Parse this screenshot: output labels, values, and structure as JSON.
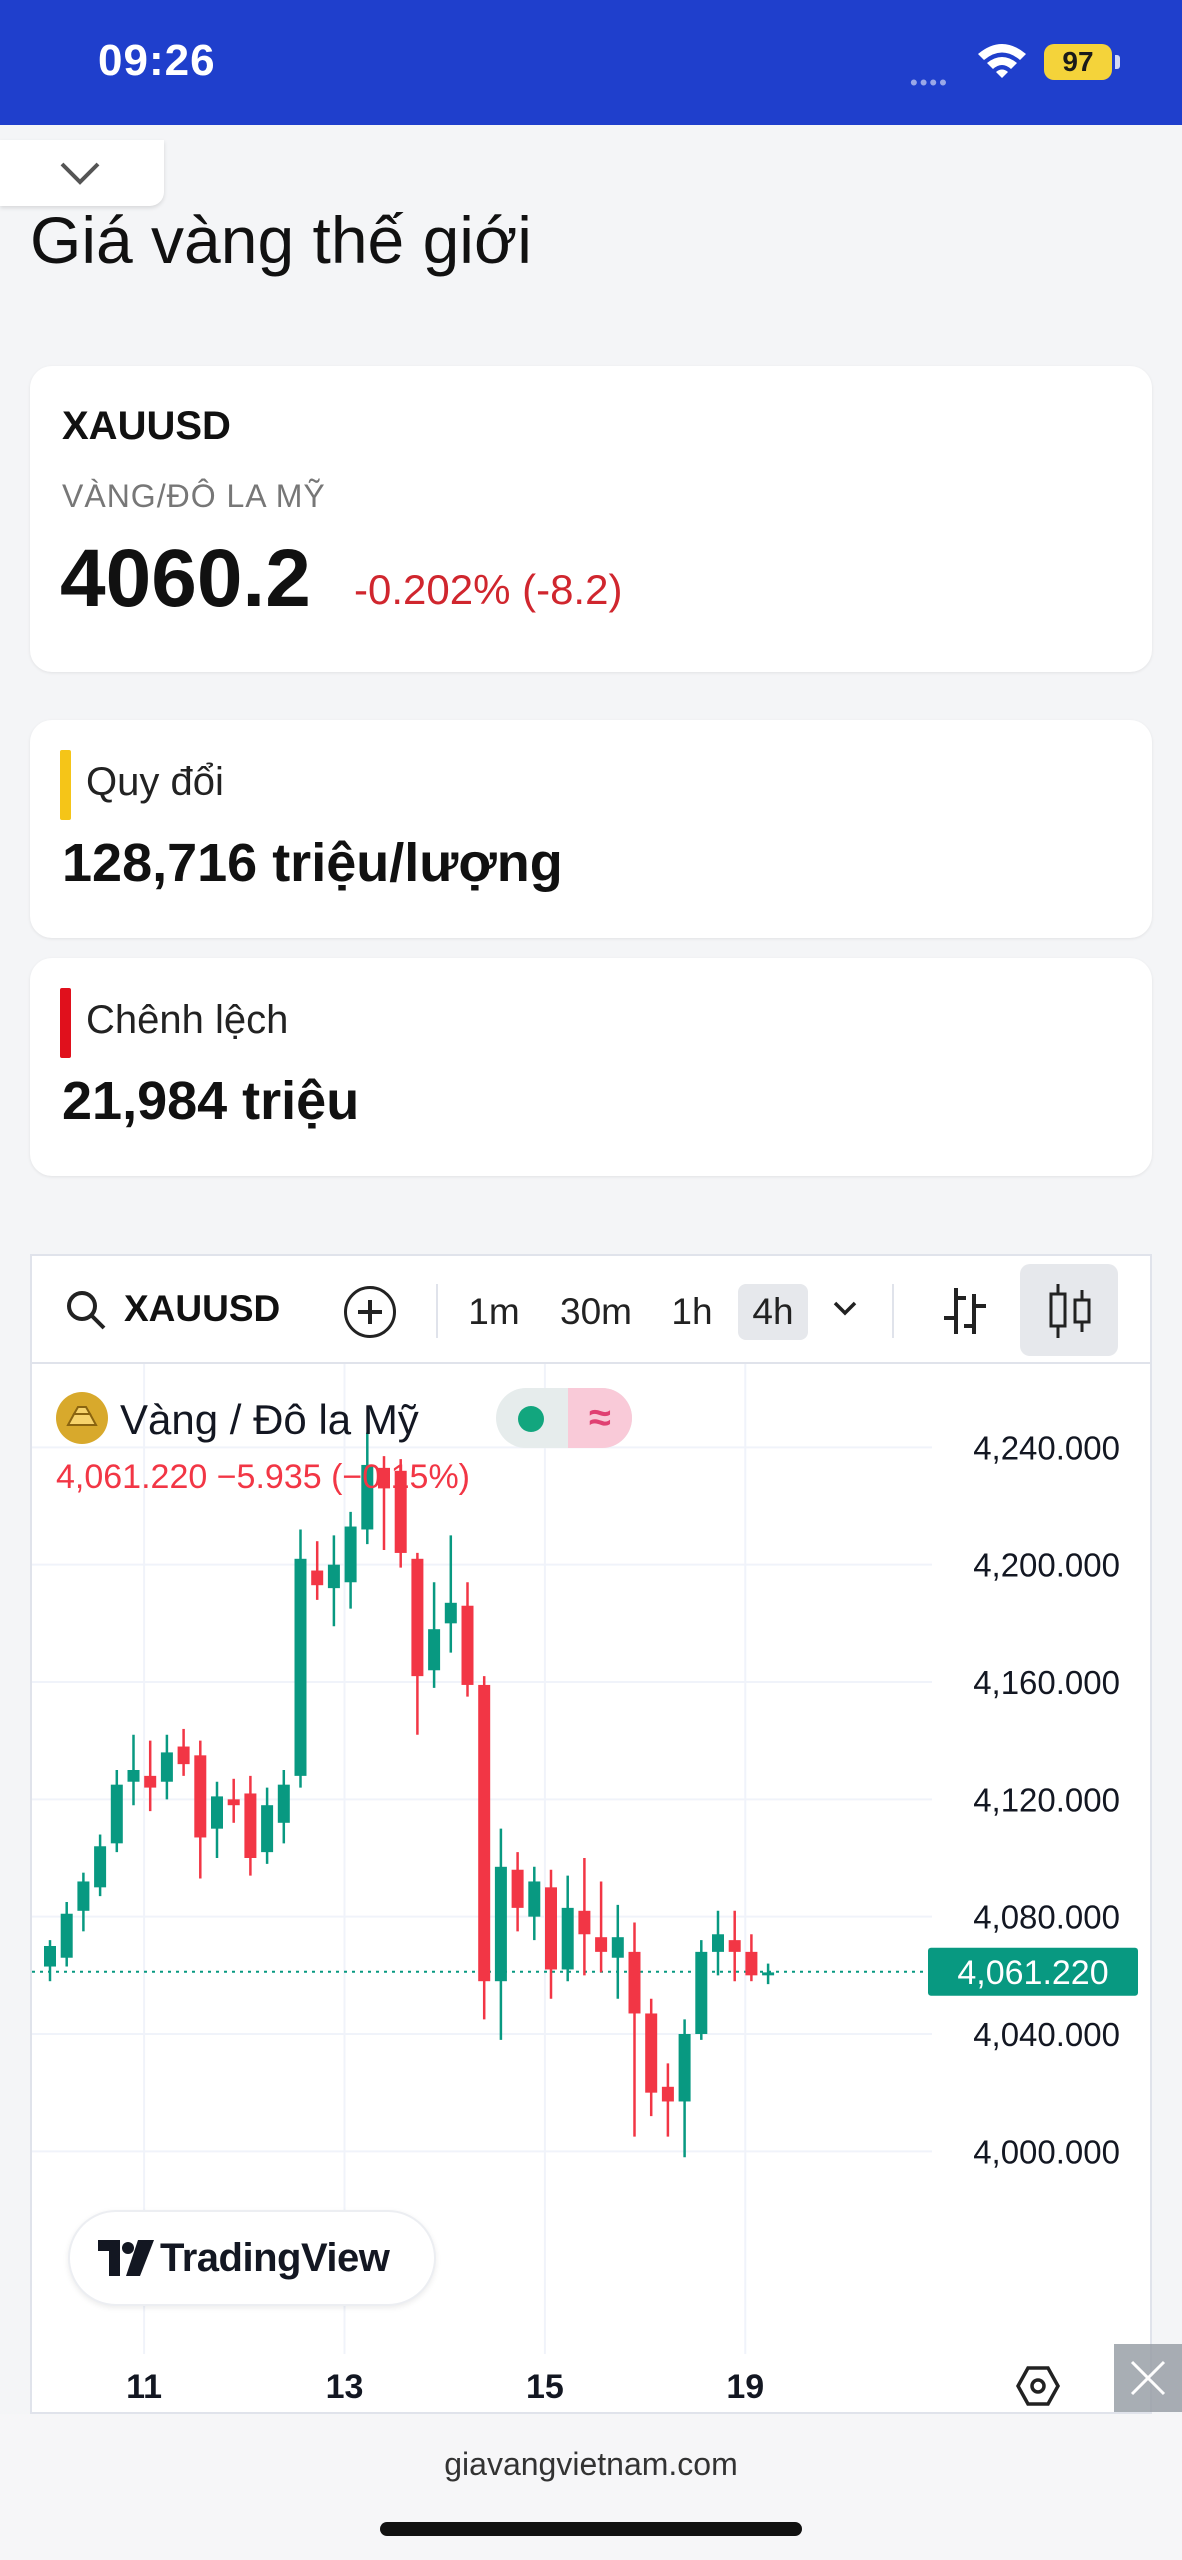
{
  "status_bar": {
    "time": "09:26",
    "signal": "••••",
    "battery": "97"
  },
  "page": {
    "title": "Giá vàng thế giới"
  },
  "quote": {
    "symbol": "XAUUSD",
    "description": "VÀNG/ĐÔ LA MỸ",
    "price": "4060.2",
    "change": "-0.202% (-8.2)"
  },
  "conversion": {
    "label": "Quy đổi",
    "value": "128,716 triệu/lượng",
    "accent": "#f5c518"
  },
  "difference": {
    "label": "Chênh lệch",
    "value": "21,984 triệu",
    "accent": "#e0101c"
  },
  "chart_widget": {
    "symbol": "XAUUSD",
    "intervals": [
      {
        "label": "1m",
        "active": false
      },
      {
        "label": "30m",
        "active": false
      },
      {
        "label": "1h",
        "active": false
      },
      {
        "label": "4h",
        "active": true
      }
    ],
    "icons": [
      "search-icon",
      "add-circle-icon",
      "chevron-down-icon",
      "bar-style-icon",
      "candle-style-icon",
      "settings-hexagon-icon",
      "close-icon"
    ],
    "legend_name": "Vàng / Đô la Mỹ",
    "legend_ohlc": "4,061.220  −5.935 (−0.15%)",
    "brand": "TradingView",
    "price_tag": "4,061.220"
  },
  "chart_data": {
    "type": "candlestick",
    "up_color": "#089981",
    "down_color": "#f23645",
    "last_price": 4061.22,
    "ylim": [
      3980,
      4250
    ],
    "yticks": [
      {
        "value": 4240,
        "label": "4,240.000"
      },
      {
        "value": 4200,
        "label": "4,200.000"
      },
      {
        "value": 4160,
        "label": "4,160.000"
      },
      {
        "value": 4120,
        "label": "4,120.000"
      },
      {
        "value": 4080,
        "label": "4,080.000"
      },
      {
        "value": 4040,
        "label": "4,040.000"
      },
      {
        "value": 4000,
        "label": "4,000.000"
      }
    ],
    "xticks": [
      {
        "index": 3,
        "label": "11"
      },
      {
        "index": 15,
        "label": "13"
      },
      {
        "index": 27,
        "label": "15"
      },
      {
        "index": 39,
        "label": "19"
      }
    ],
    "candles": [
      {
        "o": 4063,
        "h": 4072,
        "l": 4058,
        "c": 4070
      },
      {
        "o": 4066,
        "h": 4085,
        "l": 4063,
        "c": 4081
      },
      {
        "o": 4082,
        "h": 4095,
        "l": 4075,
        "c": 4092
      },
      {
        "o": 4090,
        "h": 4108,
        "l": 4087,
        "c": 4104
      },
      {
        "o": 4105,
        "h": 4130,
        "l": 4102,
        "c": 4125
      },
      {
        "o": 4126,
        "h": 4142,
        "l": 4118,
        "c": 4130
      },
      {
        "o": 4128,
        "h": 4140,
        "l": 4116,
        "c": 4124
      },
      {
        "o": 4126,
        "h": 4142,
        "l": 4120,
        "c": 4136
      },
      {
        "o": 4138,
        "h": 4144,
        "l": 4128,
        "c": 4132
      },
      {
        "o": 4135,
        "h": 4140,
        "l": 4093,
        "c": 4107
      },
      {
        "o": 4110,
        "h": 4126,
        "l": 4100,
        "c": 4121
      },
      {
        "o": 4120,
        "h": 4127,
        "l": 4112,
        "c": 4118
      },
      {
        "o": 4122,
        "h": 4128,
        "l": 4094,
        "c": 4100
      },
      {
        "o": 4102,
        "h": 4124,
        "l": 4098,
        "c": 4118
      },
      {
        "o": 4112,
        "h": 4130,
        "l": 4105,
        "c": 4125
      },
      {
        "o": 4128,
        "h": 4212,
        "l": 4124,
        "c": 4202
      },
      {
        "o": 4198,
        "h": 4208,
        "l": 4188,
        "c": 4193
      },
      {
        "o": 4192,
        "h": 4210,
        "l": 4179,
        "c": 4200
      },
      {
        "o": 4194,
        "h": 4218,
        "l": 4185,
        "c": 4213
      },
      {
        "o": 4212,
        "h": 4245,
        "l": 4207,
        "c": 4234
      },
      {
        "o": 4233,
        "h": 4237,
        "l": 4205,
        "c": 4226
      },
      {
        "o": 4232,
        "h": 4236,
        "l": 4199,
        "c": 4204
      },
      {
        "o": 4202,
        "h": 4204,
        "l": 4142,
        "c": 4162
      },
      {
        "o": 4164,
        "h": 4194,
        "l": 4158,
        "c": 4178
      },
      {
        "o": 4180,
        "h": 4210,
        "l": 4170,
        "c": 4187
      },
      {
        "o": 4186,
        "h": 4194,
        "l": 4155,
        "c": 4159
      },
      {
        "o": 4159,
        "h": 4162,
        "l": 4045,
        "c": 4058
      },
      {
        "o": 4058,
        "h": 4110,
        "l": 4038,
        "c": 4097
      },
      {
        "o": 4096,
        "h": 4102,
        "l": 4075,
        "c": 4083
      },
      {
        "o": 4080,
        "h": 4097,
        "l": 4072,
        "c": 4092
      },
      {
        "o": 4090,
        "h": 4096,
        "l": 4052,
        "c": 4062
      },
      {
        "o": 4062,
        "h": 4094,
        "l": 4058,
        "c": 4083
      },
      {
        "o": 4082,
        "h": 4100,
        "l": 4060,
        "c": 4074
      },
      {
        "o": 4073,
        "h": 4092,
        "l": 4061,
        "c": 4068
      },
      {
        "o": 4066,
        "h": 4084,
        "l": 4052,
        "c": 4073
      },
      {
        "o": 4068,
        "h": 4078,
        "l": 4005,
        "c": 4047
      },
      {
        "o": 4047,
        "h": 4052,
        "l": 4012,
        "c": 4020
      },
      {
        "o": 4022,
        "h": 4030,
        "l": 4005,
        "c": 4017
      },
      {
        "o": 4017,
        "h": 4045,
        "l": 3998,
        "c": 4040
      },
      {
        "o": 4040,
        "h": 4072,
        "l": 4038,
        "c": 4068
      },
      {
        "o": 4068,
        "h": 4082,
        "l": 4060,
        "c": 4074
      },
      {
        "o": 4072,
        "h": 4082,
        "l": 4058,
        "c": 4068
      },
      {
        "o": 4068,
        "h": 4074,
        "l": 4058,
        "c": 4060
      },
      {
        "o": 4060,
        "h": 4064,
        "l": 4057,
        "c": 4061
      }
    ]
  },
  "footer": {
    "site": "giavangvietnam.com"
  }
}
